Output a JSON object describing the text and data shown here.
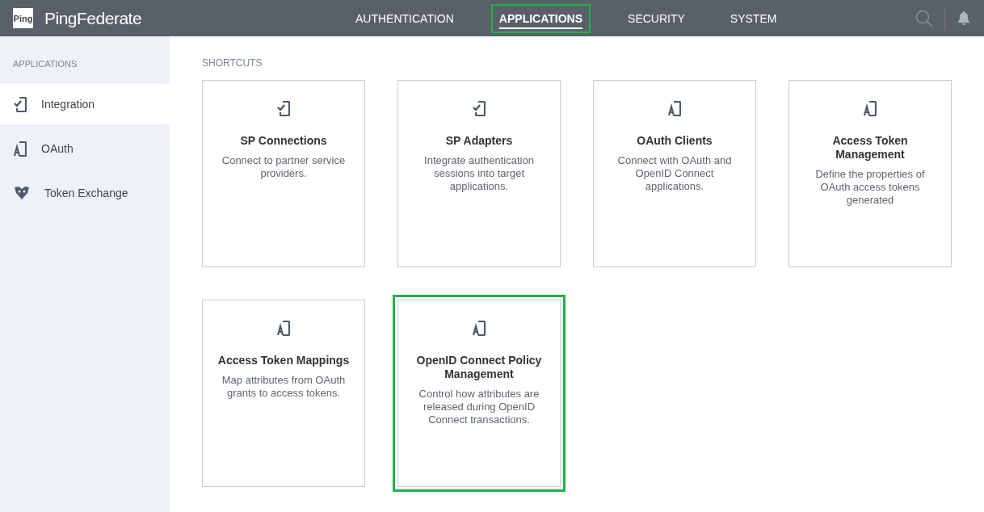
{
  "header": {
    "logo_badge": "Ping",
    "product": "PingFederate",
    "nav": [
      {
        "label": "AUTHENTICATION",
        "selected": false,
        "highlighted": false
      },
      {
        "label": "APPLICATIONS",
        "selected": true,
        "highlighted": true
      },
      {
        "label": "SECURITY",
        "selected": false,
        "highlighted": false
      },
      {
        "label": "SYSTEM",
        "selected": false,
        "highlighted": false
      }
    ]
  },
  "sidebar": {
    "heading": "APPLICATIONS",
    "items": [
      {
        "label": "Integration",
        "kind": "check",
        "selected": true
      },
      {
        "label": "OAuth",
        "kind": "a",
        "selected": false
      },
      {
        "label": "Token Exchange",
        "kind": "token",
        "selected": false
      }
    ]
  },
  "shortcuts": {
    "heading": "SHORTCUTS",
    "cards": [
      {
        "title": "SP Connections",
        "description": "Connect to partner service providers.",
        "kind": "check",
        "highlighted": false
      },
      {
        "title": "SP Adapters",
        "description": "Integrate authentication sessions into target applications.",
        "kind": "check",
        "highlighted": false
      },
      {
        "title": "OAuth Clients",
        "description": "Connect with OAuth and OpenID Connect applications.",
        "kind": "a",
        "highlighted": false
      },
      {
        "title": "Access Token Management",
        "description": "Define the properties of OAuth access tokens generated",
        "kind": "a",
        "highlighted": false
      },
      {
        "title": "Access Token Mappings",
        "description": "Map attributes from OAuth grants to access tokens.",
        "kind": "a",
        "highlighted": false
      },
      {
        "title": "OpenID Connect Policy Management",
        "description": "Control how attributes are released during OpenID Connect transactions.",
        "kind": "a",
        "highlighted": true
      }
    ]
  }
}
